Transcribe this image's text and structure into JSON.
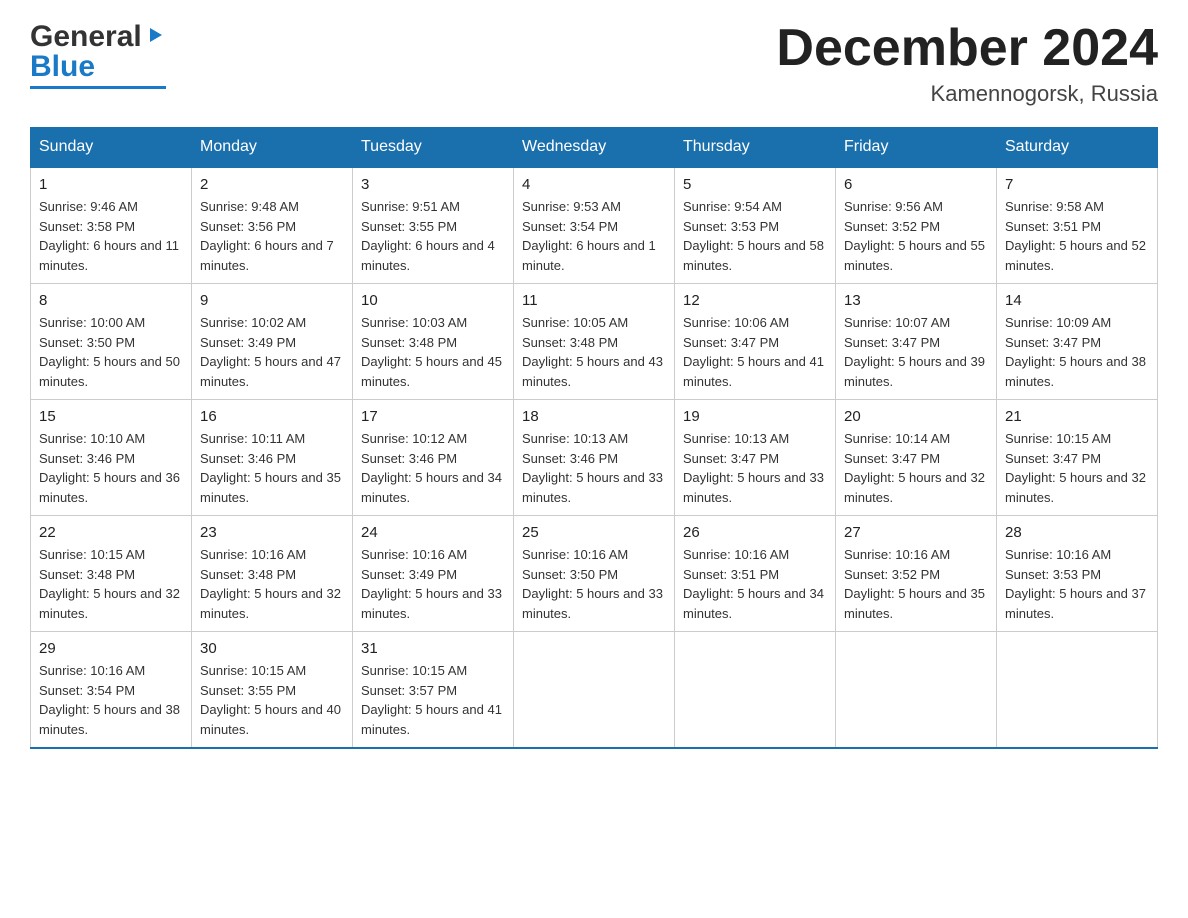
{
  "header": {
    "logo_general": "General",
    "logo_blue": "Blue",
    "month_title": "December 2024",
    "location": "Kamennogorsk, Russia"
  },
  "columns": [
    "Sunday",
    "Monday",
    "Tuesday",
    "Wednesday",
    "Thursday",
    "Friday",
    "Saturday"
  ],
  "weeks": [
    [
      {
        "day": "1",
        "sunrise": "Sunrise: 9:46 AM",
        "sunset": "Sunset: 3:58 PM",
        "daylight": "Daylight: 6 hours and 11 minutes."
      },
      {
        "day": "2",
        "sunrise": "Sunrise: 9:48 AM",
        "sunset": "Sunset: 3:56 PM",
        "daylight": "Daylight: 6 hours and 7 minutes."
      },
      {
        "day": "3",
        "sunrise": "Sunrise: 9:51 AM",
        "sunset": "Sunset: 3:55 PM",
        "daylight": "Daylight: 6 hours and 4 minutes."
      },
      {
        "day": "4",
        "sunrise": "Sunrise: 9:53 AM",
        "sunset": "Sunset: 3:54 PM",
        "daylight": "Daylight: 6 hours and 1 minute."
      },
      {
        "day": "5",
        "sunrise": "Sunrise: 9:54 AM",
        "sunset": "Sunset: 3:53 PM",
        "daylight": "Daylight: 5 hours and 58 minutes."
      },
      {
        "day": "6",
        "sunrise": "Sunrise: 9:56 AM",
        "sunset": "Sunset: 3:52 PM",
        "daylight": "Daylight: 5 hours and 55 minutes."
      },
      {
        "day": "7",
        "sunrise": "Sunrise: 9:58 AM",
        "sunset": "Sunset: 3:51 PM",
        "daylight": "Daylight: 5 hours and 52 minutes."
      }
    ],
    [
      {
        "day": "8",
        "sunrise": "Sunrise: 10:00 AM",
        "sunset": "Sunset: 3:50 PM",
        "daylight": "Daylight: 5 hours and 50 minutes."
      },
      {
        "day": "9",
        "sunrise": "Sunrise: 10:02 AM",
        "sunset": "Sunset: 3:49 PM",
        "daylight": "Daylight: 5 hours and 47 minutes."
      },
      {
        "day": "10",
        "sunrise": "Sunrise: 10:03 AM",
        "sunset": "Sunset: 3:48 PM",
        "daylight": "Daylight: 5 hours and 45 minutes."
      },
      {
        "day": "11",
        "sunrise": "Sunrise: 10:05 AM",
        "sunset": "Sunset: 3:48 PM",
        "daylight": "Daylight: 5 hours and 43 minutes."
      },
      {
        "day": "12",
        "sunrise": "Sunrise: 10:06 AM",
        "sunset": "Sunset: 3:47 PM",
        "daylight": "Daylight: 5 hours and 41 minutes."
      },
      {
        "day": "13",
        "sunrise": "Sunrise: 10:07 AM",
        "sunset": "Sunset: 3:47 PM",
        "daylight": "Daylight: 5 hours and 39 minutes."
      },
      {
        "day": "14",
        "sunrise": "Sunrise: 10:09 AM",
        "sunset": "Sunset: 3:47 PM",
        "daylight": "Daylight: 5 hours and 38 minutes."
      }
    ],
    [
      {
        "day": "15",
        "sunrise": "Sunrise: 10:10 AM",
        "sunset": "Sunset: 3:46 PM",
        "daylight": "Daylight: 5 hours and 36 minutes."
      },
      {
        "day": "16",
        "sunrise": "Sunrise: 10:11 AM",
        "sunset": "Sunset: 3:46 PM",
        "daylight": "Daylight: 5 hours and 35 minutes."
      },
      {
        "day": "17",
        "sunrise": "Sunrise: 10:12 AM",
        "sunset": "Sunset: 3:46 PM",
        "daylight": "Daylight: 5 hours and 34 minutes."
      },
      {
        "day": "18",
        "sunrise": "Sunrise: 10:13 AM",
        "sunset": "Sunset: 3:46 PM",
        "daylight": "Daylight: 5 hours and 33 minutes."
      },
      {
        "day": "19",
        "sunrise": "Sunrise: 10:13 AM",
        "sunset": "Sunset: 3:47 PM",
        "daylight": "Daylight: 5 hours and 33 minutes."
      },
      {
        "day": "20",
        "sunrise": "Sunrise: 10:14 AM",
        "sunset": "Sunset: 3:47 PM",
        "daylight": "Daylight: 5 hours and 32 minutes."
      },
      {
        "day": "21",
        "sunrise": "Sunrise: 10:15 AM",
        "sunset": "Sunset: 3:47 PM",
        "daylight": "Daylight: 5 hours and 32 minutes."
      }
    ],
    [
      {
        "day": "22",
        "sunrise": "Sunrise: 10:15 AM",
        "sunset": "Sunset: 3:48 PM",
        "daylight": "Daylight: 5 hours and 32 minutes."
      },
      {
        "day": "23",
        "sunrise": "Sunrise: 10:16 AM",
        "sunset": "Sunset: 3:48 PM",
        "daylight": "Daylight: 5 hours and 32 minutes."
      },
      {
        "day": "24",
        "sunrise": "Sunrise: 10:16 AM",
        "sunset": "Sunset: 3:49 PM",
        "daylight": "Daylight: 5 hours and 33 minutes."
      },
      {
        "day": "25",
        "sunrise": "Sunrise: 10:16 AM",
        "sunset": "Sunset: 3:50 PM",
        "daylight": "Daylight: 5 hours and 33 minutes."
      },
      {
        "day": "26",
        "sunrise": "Sunrise: 10:16 AM",
        "sunset": "Sunset: 3:51 PM",
        "daylight": "Daylight: 5 hours and 34 minutes."
      },
      {
        "day": "27",
        "sunrise": "Sunrise: 10:16 AM",
        "sunset": "Sunset: 3:52 PM",
        "daylight": "Daylight: 5 hours and 35 minutes."
      },
      {
        "day": "28",
        "sunrise": "Sunrise: 10:16 AM",
        "sunset": "Sunset: 3:53 PM",
        "daylight": "Daylight: 5 hours and 37 minutes."
      }
    ],
    [
      {
        "day": "29",
        "sunrise": "Sunrise: 10:16 AM",
        "sunset": "Sunset: 3:54 PM",
        "daylight": "Daylight: 5 hours and 38 minutes."
      },
      {
        "day": "30",
        "sunrise": "Sunrise: 10:15 AM",
        "sunset": "Sunset: 3:55 PM",
        "daylight": "Daylight: 5 hours and 40 minutes."
      },
      {
        "day": "31",
        "sunrise": "Sunrise: 10:15 AM",
        "sunset": "Sunset: 3:57 PM",
        "daylight": "Daylight: 5 hours and 41 minutes."
      },
      {
        "day": "",
        "sunrise": "",
        "sunset": "",
        "daylight": ""
      },
      {
        "day": "",
        "sunrise": "",
        "sunset": "",
        "daylight": ""
      },
      {
        "day": "",
        "sunrise": "",
        "sunset": "",
        "daylight": ""
      },
      {
        "day": "",
        "sunrise": "",
        "sunset": "",
        "daylight": ""
      }
    ]
  ]
}
